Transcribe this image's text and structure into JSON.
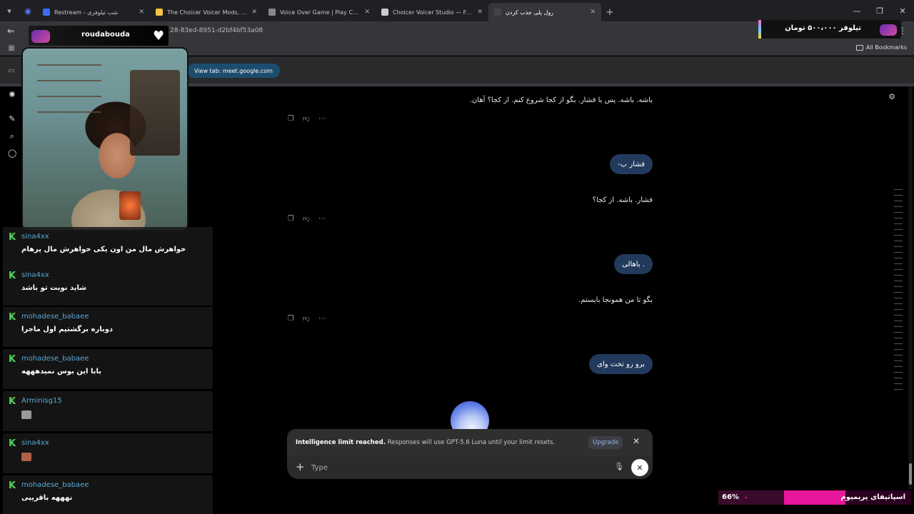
{
  "browser": {
    "tabs": [
      {
        "title": "Restream - شب تیلوفری",
        "color": "#3a6df0"
      },
      {
        "title": "The Choicer Voicer Mods, Tuto",
        "color": "#f5c542"
      },
      {
        "title": "Voice Over Game | Play Choice",
        "color": "#888888"
      },
      {
        "title": "Choicer Voicer Studio — Free C",
        "color": "#cccccc"
      },
      {
        "title": "رول پلی جذب کردن",
        "color": "#444444"
      }
    ],
    "url_fragment": "28-83ed-8951-d2bf4bf53a08",
    "all_bookmarks": "All Bookmarks"
  },
  "view_tab": "View tab: meet.google.com",
  "stream": {
    "streamer_name": "roudabouda",
    "donation_text": "تیلوفر ۵۰۰،۰۰۰ تومان"
  },
  "chat": [
    {
      "user": "sina4xx",
      "text": "خواهرش مال من اون یکی خواهرش مال پرهام"
    },
    {
      "user": "sina4xx",
      "text": "شاید نوبت تو باشد"
    },
    {
      "user": "mohadese_babaee",
      "text": "دوباره برگشتیم اول ماجرا"
    },
    {
      "user": "mohadese_babaee",
      "text": "بابا این بوس نمیدهههه"
    },
    {
      "user": "Arminisg15",
      "text": "",
      "emote_color": "#9a9a9a"
    },
    {
      "user": "sina4xx",
      "text": "",
      "emote_color": "#b0604a"
    },
    {
      "user": "mohadese_babaee",
      "text": "نهههه باقرییی"
    }
  ],
  "conversation": {
    "ai_1": "باشه. باشه. پس با فشار. بگو از کجا شروع کنم. از کجا؟ آهان.",
    "user_1": "فشار ب-",
    "ai_2": "فشار. باشه. از کجا؟",
    "user_2": ". باهالی",
    "ai_3": "بگو تا من همونجا بایستم.",
    "user_3": "برو رو تخت وای"
  },
  "notice": {
    "bold": "Intelligence limit reached.",
    "text": " Responses will use GPT-5.6 Luna until your limit resets.",
    "upgrade": "Upgrade"
  },
  "composer": {
    "placeholder": "Type"
  },
  "goal": {
    "percent_label": "66%",
    "percent": 66,
    "label": "اسپاتیفای پریمیوم"
  },
  "colors": {
    "accent_green": "#52d35a",
    "username_blue": "#5aa9d8",
    "bubble": "#223a5c",
    "goal_pink": "#e6179a"
  }
}
